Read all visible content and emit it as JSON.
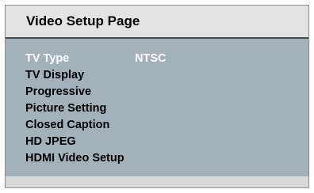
{
  "page": {
    "title": "Video Setup Page"
  },
  "menu": {
    "items": [
      {
        "label": "TV Type",
        "value": "NTSC",
        "selected": true
      },
      {
        "label": "TV Display",
        "value": ""
      },
      {
        "label": "Progressive",
        "value": ""
      },
      {
        "label": "Picture Setting",
        "value": ""
      },
      {
        "label": "Closed Caption",
        "value": ""
      },
      {
        "label": "HD JPEG",
        "value": ""
      },
      {
        "label": "HDMI Video Setup",
        "value": ""
      }
    ]
  },
  "colors": {
    "panel": "#a3b1bb",
    "header": "#e3e3e3",
    "selected_text": "#ffffff"
  }
}
